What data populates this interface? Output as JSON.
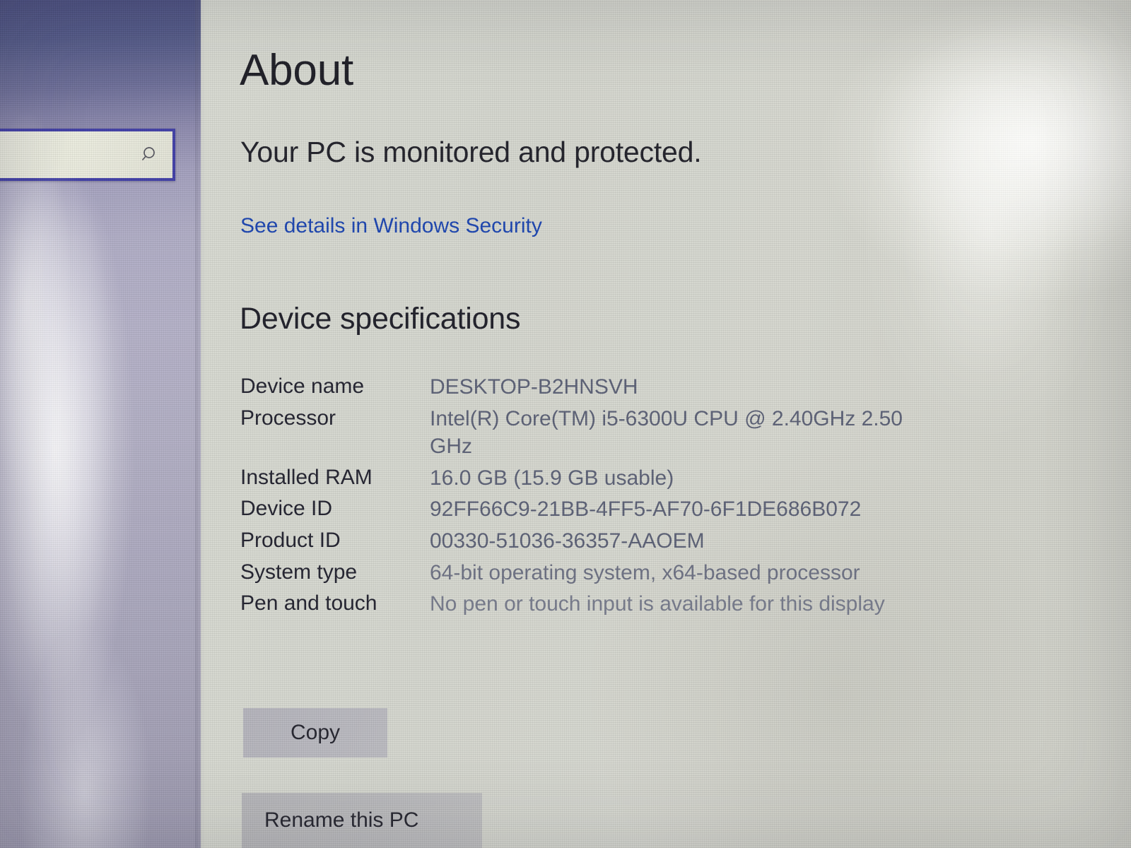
{
  "left_pane": {
    "search": {
      "value": "",
      "placeholder": "",
      "icon": "search-icon"
    }
  },
  "page": {
    "title": "About",
    "protection_status": "Your PC is monitored and protected.",
    "security_link": "See details in Windows Security",
    "section_heading": "Device specifications"
  },
  "specifications": [
    {
      "label": "Device name",
      "value": "DESKTOP-B2HNSVH"
    },
    {
      "label": "Processor",
      "value": "Intel(R) Core(TM) i5-6300U CPU @ 2.40GHz   2.50 GHz"
    },
    {
      "label": "Installed RAM",
      "value": "16.0 GB (15.9 GB usable)"
    },
    {
      "label": "Device ID",
      "value": "92FF66C9-21BB-4FF5-AF70-6F1DE686B072"
    },
    {
      "label": "Product ID",
      "value": "00330-51036-36357-AAOEM"
    },
    {
      "label": "System type",
      "value": "64-bit operating system, x64-based processor"
    },
    {
      "label": "Pen and touch",
      "value": "No pen or touch input is available for this display"
    }
  ],
  "actions": {
    "copy_label": "Copy",
    "rename_label": "Rename this PC"
  },
  "colors": {
    "link": "#1c45b0",
    "label_text": "#232330",
    "value_text": "#5c6176",
    "accent_border": "#4240a6",
    "screen_background": "#d6d8d1"
  }
}
